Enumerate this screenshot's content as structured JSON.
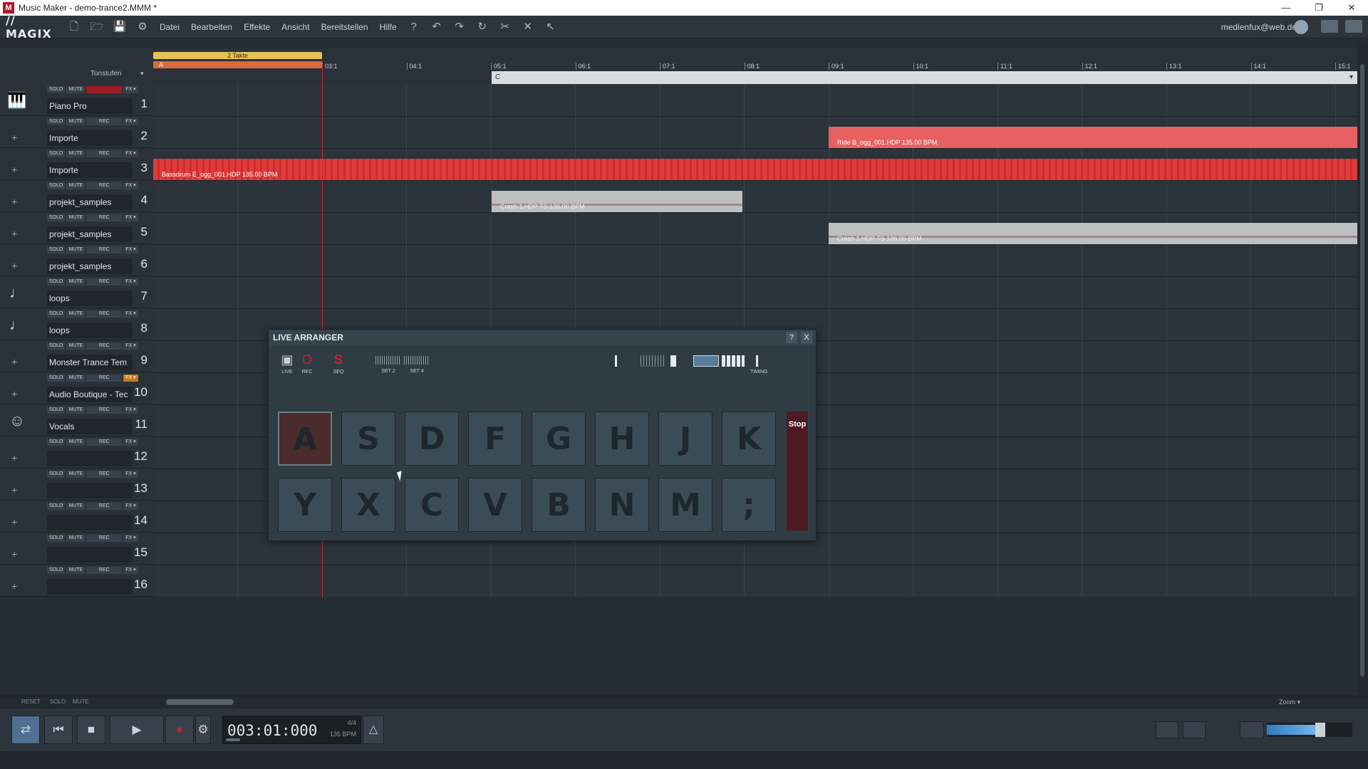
{
  "window": {
    "title": "Music Maker - demo-trance2.MMM *",
    "app_icon": "M",
    "controls": [
      "—",
      "❐",
      "✕"
    ]
  },
  "menubar": {
    "logo": "// MAGIX",
    "items": [
      "Datei",
      "Bearbeiten",
      "Effekte",
      "Ansicht",
      "Bereitstellen",
      "Hilfe"
    ],
    "user": "medienfux@web.de"
  },
  "ruler": {
    "tonstufen_label": "Tonstufen",
    "loop_label": "2 Takte",
    "marker_label": "A",
    "chord_label": "C",
    "ticks": [
      "03:1",
      "04:1",
      "05:1",
      "06:1",
      "07:1",
      "08:1",
      "09:1",
      "10:1",
      "11:1",
      "12:1",
      "13:1",
      "14:1",
      "15:1"
    ]
  },
  "tracks": [
    {
      "name": "Piano Pro",
      "num": "1",
      "icon": "piano-icon",
      "rec_active": true,
      "fx_active": false
    },
    {
      "name": "Importe",
      "num": "2",
      "icon": "plus-icon",
      "rec_active": false,
      "fx_active": false
    },
    {
      "name": "Importe",
      "num": "3",
      "icon": "plus-icon",
      "rec_active": false,
      "fx_active": false
    },
    {
      "name": "projekt_samples",
      "num": "4",
      "icon": "plus-icon",
      "rec_active": false,
      "fx_active": false
    },
    {
      "name": "projekt_samples",
      "num": "5",
      "icon": "plus-icon",
      "rec_active": false,
      "fx_active": false
    },
    {
      "name": "projekt_samples",
      "num": "6",
      "icon": "plus-icon",
      "rec_active": false,
      "fx_active": false
    },
    {
      "name": "loops",
      "num": "7",
      "icon": "note-icon",
      "rec_active": false,
      "fx_active": false
    },
    {
      "name": "loops",
      "num": "8",
      "icon": "note-icon",
      "rec_active": false,
      "fx_active": false
    },
    {
      "name": "Monster Trance Tem",
      "num": "9",
      "icon": "plus-icon",
      "rec_active": false,
      "fx_active": false
    },
    {
      "name": "Audio Boutique - Tec",
      "num": "10",
      "icon": "plus-icon",
      "rec_active": false,
      "fx_active": true
    },
    {
      "name": "Vocals",
      "num": "11",
      "icon": "vocals-icon",
      "rec_active": false,
      "fx_active": false
    },
    {
      "name": "",
      "num": "12",
      "icon": "plus-icon",
      "rec_active": false,
      "fx_active": false
    },
    {
      "name": "",
      "num": "13",
      "icon": "plus-icon",
      "rec_active": false,
      "fx_active": false
    },
    {
      "name": "",
      "num": "14",
      "icon": "plus-icon",
      "rec_active": false,
      "fx_active": false
    },
    {
      "name": "",
      "num": "15",
      "icon": "plus-icon",
      "rec_active": false,
      "fx_active": false
    },
    {
      "name": "",
      "num": "16",
      "icon": "plus-icon",
      "rec_active": false,
      "fx_active": false
    }
  ],
  "track_buttons": {
    "solo": "SOLO",
    "mute": "MUTE",
    "rec": "REC",
    "fx": "FX ▾"
  },
  "clips": [
    {
      "label": "Ride B_ogg_001.HDP  135.00 BPM"
    },
    {
      "label": "Bassdrum E_ogg_001.HDP  135.00 BPM"
    },
    {
      "label": "Crash 1.HDP  TS  136.00 BPM"
    },
    {
      "label": "Crash 1.HDP  TS  136.00 BPM"
    }
  ],
  "bottom_strip": {
    "reset": "RESET",
    "solo": "SOLO",
    "mute": "MUTE",
    "zoom": "Zoom ▾"
  },
  "transport": {
    "timecode": "003:01:000",
    "signature": "4/4",
    "bpm": "135 BPM"
  },
  "live_arranger": {
    "title": "LIVE ARRANGER",
    "help": "?",
    "close": "X",
    "modes": [
      {
        "label": "LIVE",
        "glyph": "▣"
      },
      {
        "label": "REC",
        "glyph": "O"
      },
      {
        "label": "SEQ",
        "glyph": "S"
      }
    ],
    "sets": [
      "SET 2",
      "SET 4"
    ],
    "timing_label": "TIMING",
    "keys_row1": [
      "A",
      "S",
      "D",
      "F",
      "G",
      "H",
      "J",
      "K"
    ],
    "keys_row2": [
      "Y",
      "X",
      "C",
      "V",
      "B",
      "N",
      "M",
      ";"
    ],
    "stop": "Stop",
    "active_key": "A"
  },
  "colors": {
    "accent": "#e03b3b",
    "playhead": "#c4293a",
    "loop": "#e5c25a"
  }
}
